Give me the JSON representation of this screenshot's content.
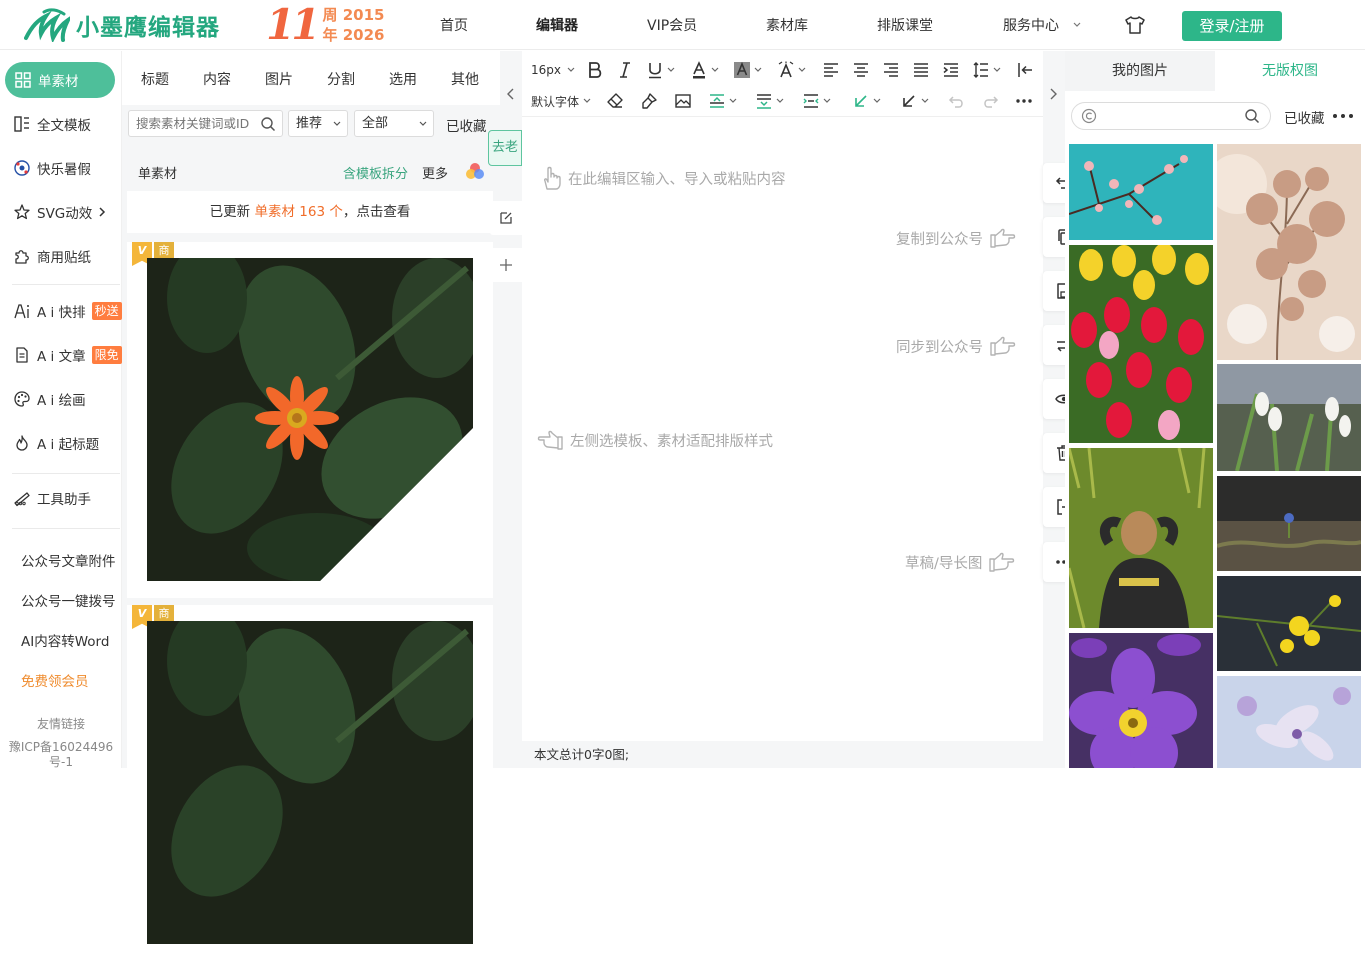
{
  "brand": {
    "name": "小墨鹰编辑器",
    "anniversary_number": "11",
    "anniversary_label": "周",
    "year_start": "2015",
    "year_end_prefix": "年",
    "year_end": "2026"
  },
  "nav": {
    "items": [
      "首页",
      "编辑器",
      "VIP会员",
      "素材库",
      "排版课堂",
      "服务中心"
    ],
    "active": "编辑器",
    "login_label": "登录/注册"
  },
  "leftnav": {
    "items": [
      {
        "label": "单素材",
        "icon": "grid-icon",
        "active": true
      },
      {
        "label": "全文模板",
        "icon": "template-icon"
      },
      {
        "label": "快乐暑假",
        "icon": "ball-icon"
      },
      {
        "label": "SVG动效",
        "icon": "star-icon"
      },
      {
        "label": "商用贴纸",
        "icon": "puzzle-icon"
      },
      {
        "label": "A i 快排",
        "icon": "ai-pen-icon",
        "tag": "秒送"
      },
      {
        "label": "A i 文章",
        "icon": "document-icon",
        "tag": "限免"
      },
      {
        "label": "A i 绘画",
        "icon": "palette-icon"
      },
      {
        "label": "A i 起标题",
        "icon": "flame-icon"
      },
      {
        "label": "工具助手",
        "icon": "ruler-icon"
      }
    ],
    "links": [
      "公众号文章附件",
      "公众号一键拨号",
      "AI内容转Word",
      "免费领会员"
    ],
    "friend_links": "友情链接",
    "icp_line1": "豫ICP备16024496",
    "icp_line2": "号-1"
  },
  "material": {
    "tabs": [
      "标题",
      "内容",
      "图片",
      "分割",
      "选用",
      "其他"
    ],
    "search_placeholder": "搜索素材关键词或ID",
    "sort_value": "推荐",
    "scope_value": "全部",
    "collected": "已收藏",
    "section_title": "单素材",
    "split_link": "含模板拆分",
    "more": "更多",
    "update_prefix": "已更新 ",
    "update_highlight": "单素材 163 个",
    "update_suffix": "，点击查看",
    "badge_v": "V",
    "badge_s": "商"
  },
  "side_buttons": {
    "go_old": "去老"
  },
  "editor": {
    "font_size": "16px",
    "font_family": "默认字体",
    "hint_input": "在此编辑区输入、导入或粘贴内容",
    "hint_copy": "复制到公众号",
    "hint_sync": "同步到公众号",
    "hint_template": "左侧选模板、素材适配排版样式",
    "hint_draft": "草稿/导长图",
    "status": "本文总计0字0图;"
  },
  "image_panel": {
    "tab_mine": "我的图片",
    "tab_free": "无版权图",
    "collected": "已收藏",
    "images": [
      "blossom-branch",
      "dried-flowers",
      "tulips",
      "snowdrops",
      "man-in-grass",
      "ground-flower",
      "yellow-flowers",
      "purple-primrose",
      "lilac-flowers"
    ]
  },
  "colors": {
    "brand_green": "#2db689",
    "active_nav": "#4ebf9a",
    "accent_orange": "#f06d2a",
    "tag_orange": "#ff7d3f"
  }
}
